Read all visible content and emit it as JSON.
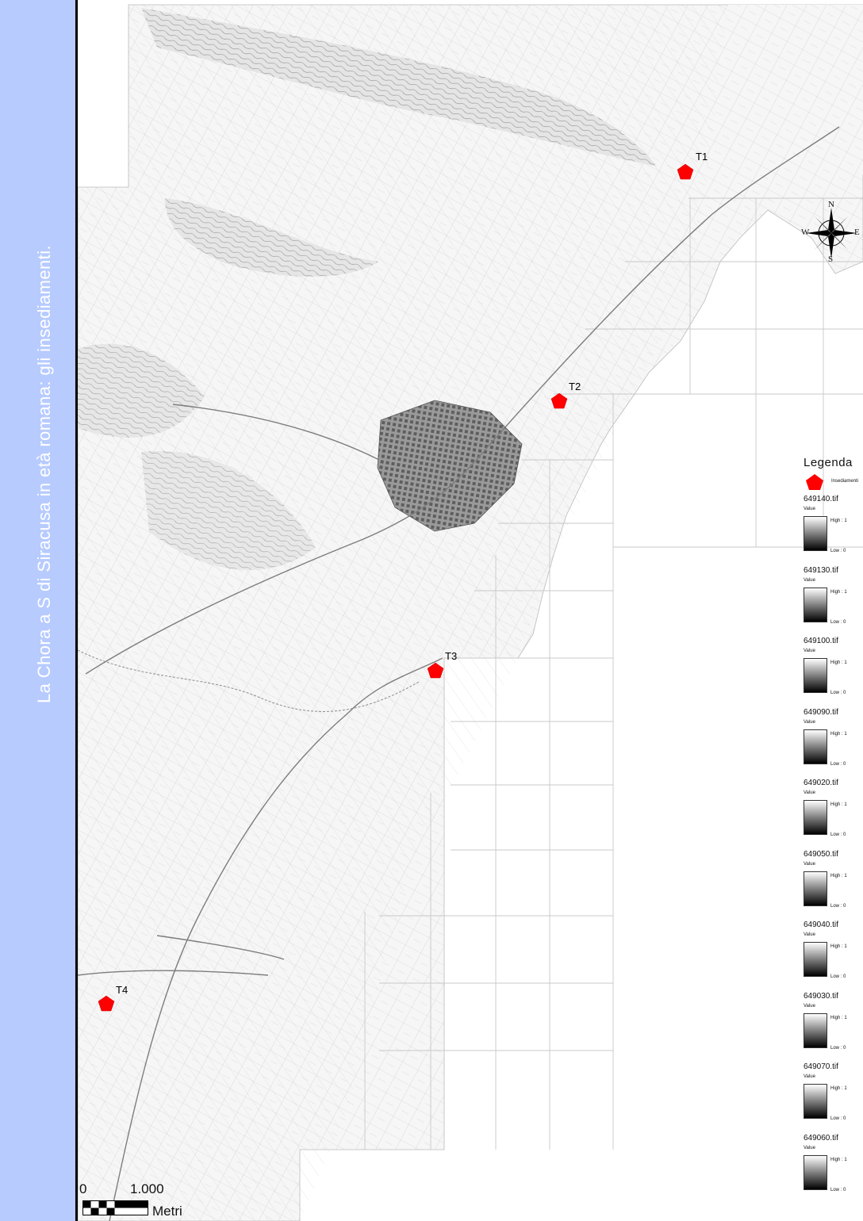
{
  "title": "La Chora a S di Siracusa in età romana: gli insediamenti.",
  "markers": [
    {
      "id": "T1",
      "label": "T1"
    },
    {
      "id": "T2",
      "label": "T2"
    },
    {
      "id": "T3",
      "label": "T3"
    },
    {
      "id": "T4",
      "label": "T4"
    }
  ],
  "compass": {
    "north": "N",
    "south": "S",
    "east": "E",
    "west": "W"
  },
  "legend": {
    "title": "Legenda",
    "symbol_label": "Insediamenti",
    "value_label": "Value",
    "high_label": "High : 1",
    "low_label": "Low : 0",
    "rasters": [
      "649140.tif",
      "649130.tif",
      "649100.tif",
      "649090.tif",
      "649020.tif",
      "649050.tif",
      "649040.tif",
      "649030.tif",
      "649070.tif",
      "649060.tif"
    ]
  },
  "scale_bar": {
    "zero": "0",
    "max": "1.000",
    "unit": "Metri"
  },
  "colors": {
    "band": "#b7cbff",
    "marker": "#ff0000",
    "sea": "#ffffff"
  },
  "icons": {
    "marker": "pentagon-icon",
    "compass": "compass-rose-icon"
  }
}
